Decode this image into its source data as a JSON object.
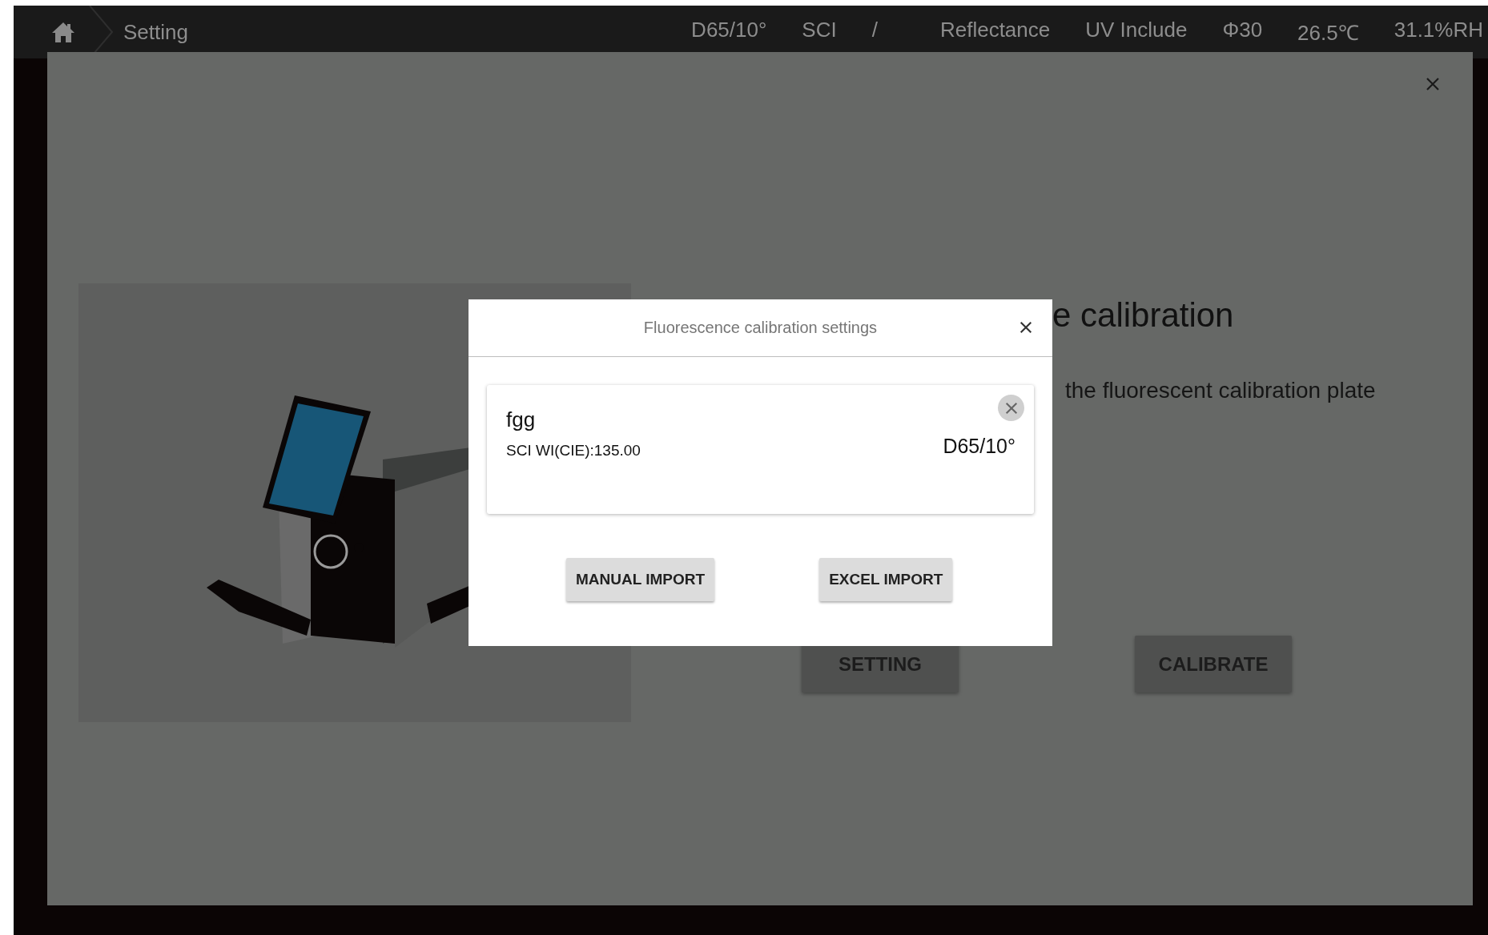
{
  "status_bar": {
    "title": "Setting",
    "items": [
      "D65/10°",
      "SCI",
      "/",
      "Reflectance",
      "UV Include",
      "Φ30",
      "26.5℃",
      "31.1%RH"
    ]
  },
  "page": {
    "title": "e calibration",
    "instruction": "the fluorescent calibration plate",
    "buttons": [
      "SETTING",
      "CALIBRATE"
    ]
  },
  "dialog": {
    "title": "Fluorescence calibration settings",
    "entries": [
      {
        "name": "fgg",
        "value": "SCI WI(CIE):135.00",
        "illuminant": "D65/10°"
      }
    ],
    "buttons": [
      "MANUAL IMPORT",
      "EXCEL IMPORT"
    ]
  }
}
